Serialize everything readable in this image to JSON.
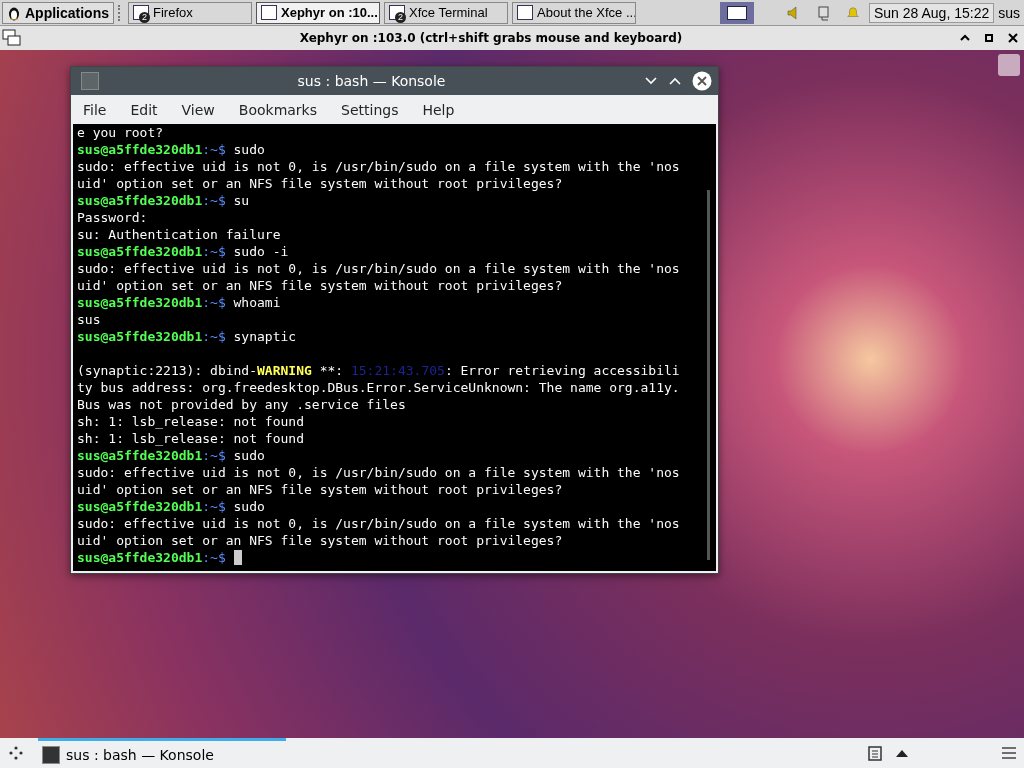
{
  "top_panel": {
    "menu_button": "Applications",
    "tasks": [
      {
        "label": "Firefox",
        "badge": "2",
        "selected": false
      },
      {
        "label": "Xephyr on :10...",
        "selected": true
      },
      {
        "label": "Xfce Terminal",
        "badge": "2",
        "selected": false
      },
      {
        "label": "About the Xfce ...",
        "selected": false
      }
    ],
    "clock": "Sun 28 Aug, 15:22",
    "user": "sus"
  },
  "xephyr": {
    "title": "Xephyr on :103.0 (ctrl+shift grabs mouse and keyboard)"
  },
  "konsole": {
    "title": "sus : bash — Konsole",
    "menu": [
      "File",
      "Edit",
      "View",
      "Bookmarks",
      "Settings",
      "Help"
    ],
    "lines": [
      {
        "kind": "text",
        "text": "e you root?"
      },
      {
        "kind": "prompt",
        "user": "sus@a5ffde320db1",
        "path": ":~$",
        "command": " sudo"
      },
      {
        "kind": "text",
        "text": "sudo: effective uid is not 0, is /usr/bin/sudo on a file system with the 'nos"
      },
      {
        "kind": "text",
        "text": "uid' option set or an NFS file system without root privileges?"
      },
      {
        "kind": "prompt",
        "user": "sus@a5ffde320db1",
        "path": ":~$",
        "command": " su"
      },
      {
        "kind": "text",
        "text": "Password:"
      },
      {
        "kind": "text",
        "text": "su: Authentication failure"
      },
      {
        "kind": "prompt",
        "user": "sus@a5ffde320db1",
        "path": ":~$",
        "command": " sudo -i"
      },
      {
        "kind": "text",
        "text": "sudo: effective uid is not 0, is /usr/bin/sudo on a file system with the 'nos"
      },
      {
        "kind": "text",
        "text": "uid' option set or an NFS file system without root privileges?"
      },
      {
        "kind": "prompt",
        "user": "sus@a5ffde320db1",
        "path": ":~$",
        "command": " whoami"
      },
      {
        "kind": "text",
        "text": "sus"
      },
      {
        "kind": "prompt",
        "user": "sus@a5ffde320db1",
        "path": ":~$",
        "command": " synaptic"
      },
      {
        "kind": "blank"
      },
      {
        "kind": "warning",
        "parts": [
          {
            "kind": "plain",
            "text": "(synaptic:2213): dbind-"
          },
          {
            "kind": "warn",
            "text": "WARNING"
          },
          {
            "kind": "plain",
            "text": " **: "
          },
          {
            "kind": "time",
            "text": "15:21:43.705"
          },
          {
            "kind": "plain",
            "text": ": Error retrieving accessibili"
          }
        ]
      },
      {
        "kind": "text",
        "text": "ty bus address: org.freedesktop.DBus.Error.ServiceUnknown: The name org.a11y."
      },
      {
        "kind": "text",
        "text": "Bus was not provided by any .service files"
      },
      {
        "kind": "text",
        "text": "sh: 1: lsb_release: not found"
      },
      {
        "kind": "text",
        "text": "sh: 1: lsb_release: not found"
      },
      {
        "kind": "prompt",
        "user": "sus@a5ffde320db1",
        "path": ":~$",
        "command": " sudo"
      },
      {
        "kind": "text",
        "text": "sudo: effective uid is not 0, is /usr/bin/sudo on a file system with the 'nos"
      },
      {
        "kind": "text",
        "text": "uid' option set or an NFS file system without root privileges?"
      },
      {
        "kind": "prompt",
        "user": "sus@a5ffde320db1",
        "path": ":~$",
        "command": " sudo"
      },
      {
        "kind": "text",
        "text": "sudo: effective uid is not 0, is /usr/bin/sudo on a file system with the 'nos"
      },
      {
        "kind": "text",
        "text": "uid' option set or an NFS file system without root privileges?"
      },
      {
        "kind": "prompt",
        "user": "sus@a5ffde320db1",
        "path": ":~$",
        "cursor": true
      }
    ]
  },
  "bottom_panel": {
    "task": "sus : bash — Konsole"
  }
}
